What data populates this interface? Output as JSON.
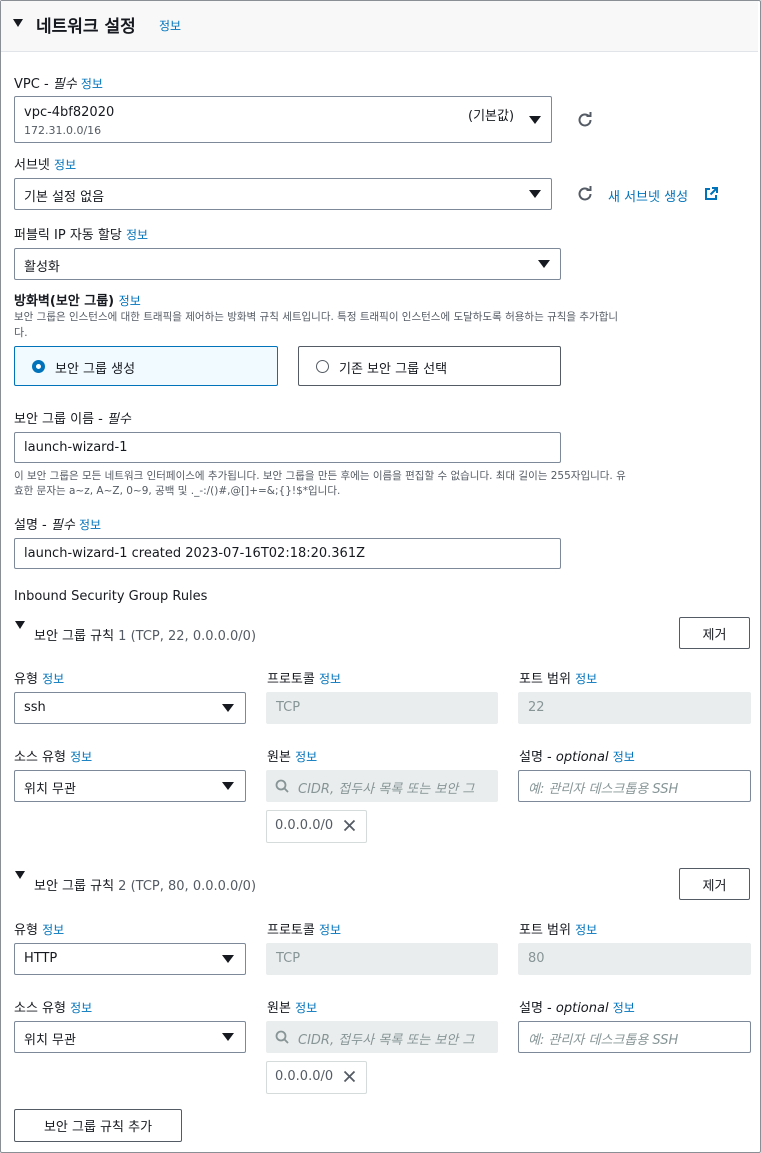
{
  "section": {
    "title": "네트워크 설정",
    "info": "정보"
  },
  "vpc": {
    "label": "VPC - ",
    "required": "필수",
    "info": "정보",
    "value": "vpc-4bf82020",
    "default_tag": "(기본값)",
    "cidr": "172.31.0.0/16"
  },
  "subnet": {
    "label": "서브넷",
    "info": "정보",
    "value": "기본 설정 없음",
    "create_link": "새 서브넷 생성"
  },
  "public_ip": {
    "label": "퍼블릭 IP 자동 할당",
    "info": "정보",
    "value": "활성화"
  },
  "firewall": {
    "label": "방화벽(보안 그룹)",
    "info": "정보",
    "desc_line1": "보안 그룹은 인스턴스에 대한 트래픽을 제어하는 방화벽 규칙 세트입니다. 특정 트래픽이 인스턴스에 도달하도록 허용하는 규칙을 추가합니",
    "desc_line2": "다.",
    "option_create": "보안 그룹 생성",
    "option_existing": "기존 보안 그룹 선택",
    "selected": "보안 그룹 생성"
  },
  "sg_name": {
    "label": "보안 그룹 이름 - ",
    "required": "필수",
    "value": "launch-wizard-1",
    "help_line1": "이 보안 그룹은 모든 네트워크 인터페이스에 추가됩니다. 보안 그룹을 만든 후에는 이름을 편집할 수 없습니다. 최대 길이는 255자입니다. 유",
    "help_line2": "효한 문자는 a~z, A~Z, 0~9, 공백 및 ._-:/()#,@[]+=&;{}!$*입니다."
  },
  "description": {
    "label": "설명 - ",
    "required": "필수",
    "info": "정보",
    "value": "launch-wizard-1 created 2023-07-16T02:18:20.361Z"
  },
  "inbound": {
    "heading": "Inbound Security Group Rules",
    "labels": {
      "type": "유형",
      "protocol": "프로토콜",
      "port_range": "포트 범위",
      "source_type": "소스 유형",
      "source": "원본",
      "desc": "설명 - ",
      "optional": "optional",
      "info": "정보"
    },
    "remove_label": "제거",
    "source_placeholder": "CIDR, 접두사 목록 또는 보안 그",
    "desc_placeholder": "예: 관리자 데스크톱용 SSH",
    "rules": [
      {
        "title": "보안 그룹 규칙",
        "summary": "1 (TCP, 22, 0.0.0.0/0)",
        "type": "ssh",
        "protocol": "TCP",
        "port": "22",
        "source_type": "위치 무관",
        "source_token": "0.0.0.0/0"
      },
      {
        "title": "보안 그룹 규칙",
        "summary": "2 (TCP, 80, 0.0.0.0/0)",
        "type": "HTTP",
        "protocol": "TCP",
        "port": "80",
        "source_type": "위치 무관",
        "source_token": "0.0.0.0/0"
      }
    ],
    "add_rule_label": "보안 그룹 규칙 추가"
  },
  "colors": {
    "link": "#0073bb",
    "border": "#7d8998",
    "disabled_bg": "#eaeded",
    "selected_bg": "#f1faff"
  },
  "icons": [
    "caret-down-icon",
    "refresh-icon",
    "external-link-icon",
    "radio-icon",
    "search-icon",
    "close-icon"
  ]
}
